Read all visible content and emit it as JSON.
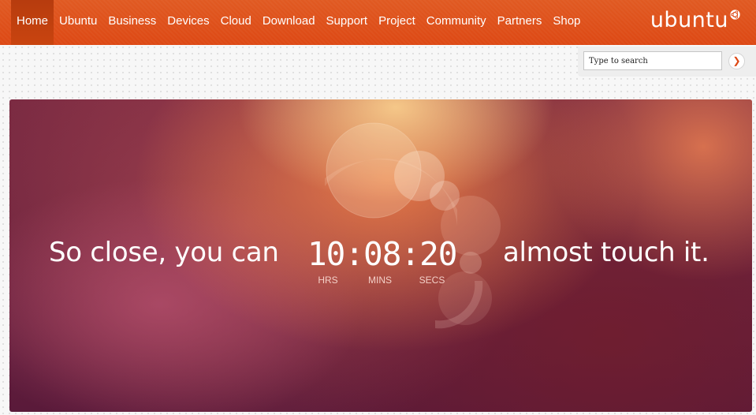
{
  "nav": {
    "items": [
      {
        "label": "Home",
        "active": true
      },
      {
        "label": "Ubuntu",
        "active": false
      },
      {
        "label": "Business",
        "active": false
      },
      {
        "label": "Devices",
        "active": false
      },
      {
        "label": "Cloud",
        "active": false
      },
      {
        "label": "Download",
        "active": false
      },
      {
        "label": "Support",
        "active": false
      },
      {
        "label": "Project",
        "active": false
      },
      {
        "label": "Community",
        "active": false
      },
      {
        "label": "Partners",
        "active": false
      },
      {
        "label": "Shop",
        "active": false
      }
    ],
    "logo_text": "ubuntu",
    "logo_icon": "circle-of-friends-icon",
    "brand_color": "#dd4814"
  },
  "search": {
    "placeholder": "Type to search",
    "button_icon": "chevron-right-icon",
    "button_glyph": "❯"
  },
  "hero": {
    "text_left": "So close, you can",
    "text_right": "almost touch it.",
    "countdown": {
      "display": "10:08:20",
      "hours": "10",
      "minutes": "08",
      "seconds": "20",
      "labels": {
        "hours": "HRS",
        "minutes": "MINS",
        "seconds": "SECS"
      }
    }
  }
}
